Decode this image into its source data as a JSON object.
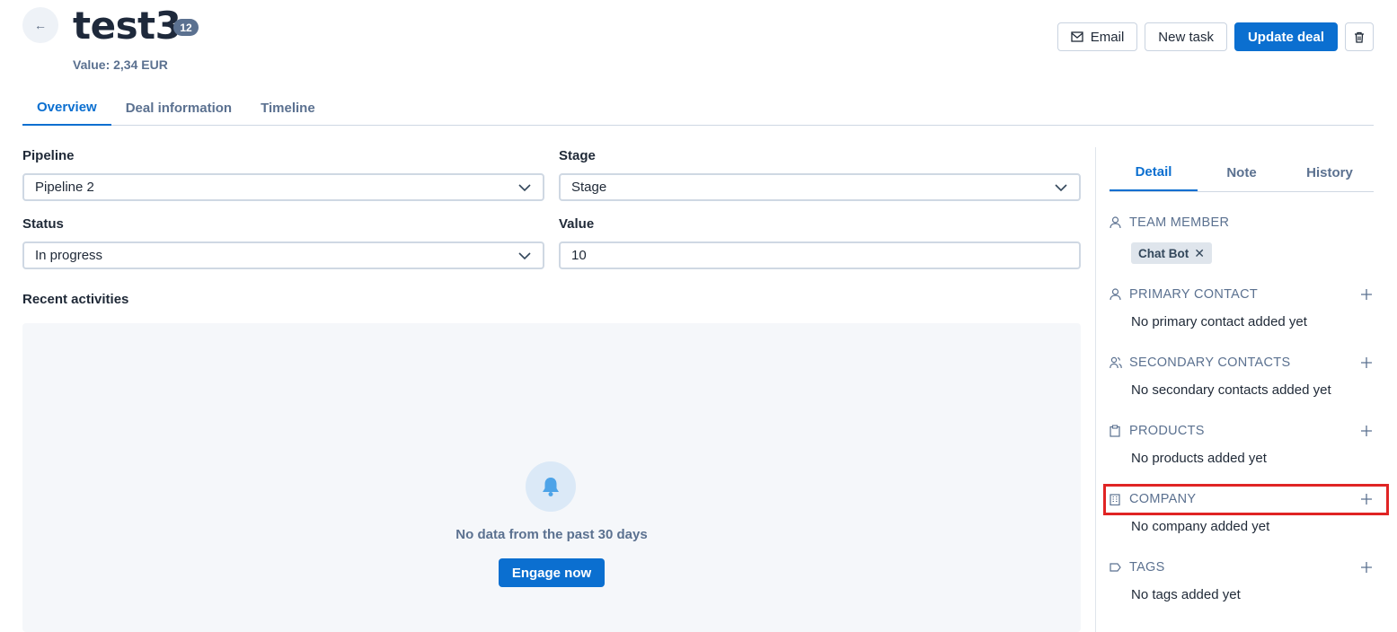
{
  "header": {
    "title": "test3",
    "count": "12",
    "value_line": "Value: 2,34 EUR"
  },
  "actions": {
    "email_label": "Email",
    "new_task_label": "New task",
    "update_label": "Update deal"
  },
  "tabs": [
    {
      "label": "Overview",
      "active": true
    },
    {
      "label": "Deal information",
      "active": false
    },
    {
      "label": "Timeline",
      "active": false
    }
  ],
  "form": {
    "pipeline_label": "Pipeline",
    "pipeline_value": "Pipeline 2",
    "stage_label": "Stage",
    "stage_value": "Stage",
    "status_label": "Status",
    "status_value": "In progress",
    "value_label": "Value",
    "value_value": "10"
  },
  "recent": {
    "label": "Recent activities",
    "empty_text": "No data from the past 30 days",
    "engage_label": "Engage now"
  },
  "sidebar": {
    "tabs": [
      {
        "label": "Detail",
        "active": true
      },
      {
        "label": "Note",
        "active": false
      },
      {
        "label": "History",
        "active": false
      }
    ],
    "team_member": {
      "title": "TEAM MEMBER",
      "chip": "Chat Bot"
    },
    "primary_contact": {
      "title": "PRIMARY CONTACT",
      "empty": "No primary contact added yet"
    },
    "secondary_contacts": {
      "title": "SECONDARY CONTACTS",
      "empty": "No secondary contacts added yet"
    },
    "products": {
      "title": "PRODUCTS",
      "empty": "No products added yet"
    },
    "company": {
      "title": "COMPANY",
      "empty": "No company added yet"
    },
    "tags": {
      "title": "TAGS",
      "empty": "No tags added yet"
    }
  },
  "colors": {
    "accent": "#0b6fd0",
    "muted": "#5b7190",
    "highlight": "#e02424"
  }
}
